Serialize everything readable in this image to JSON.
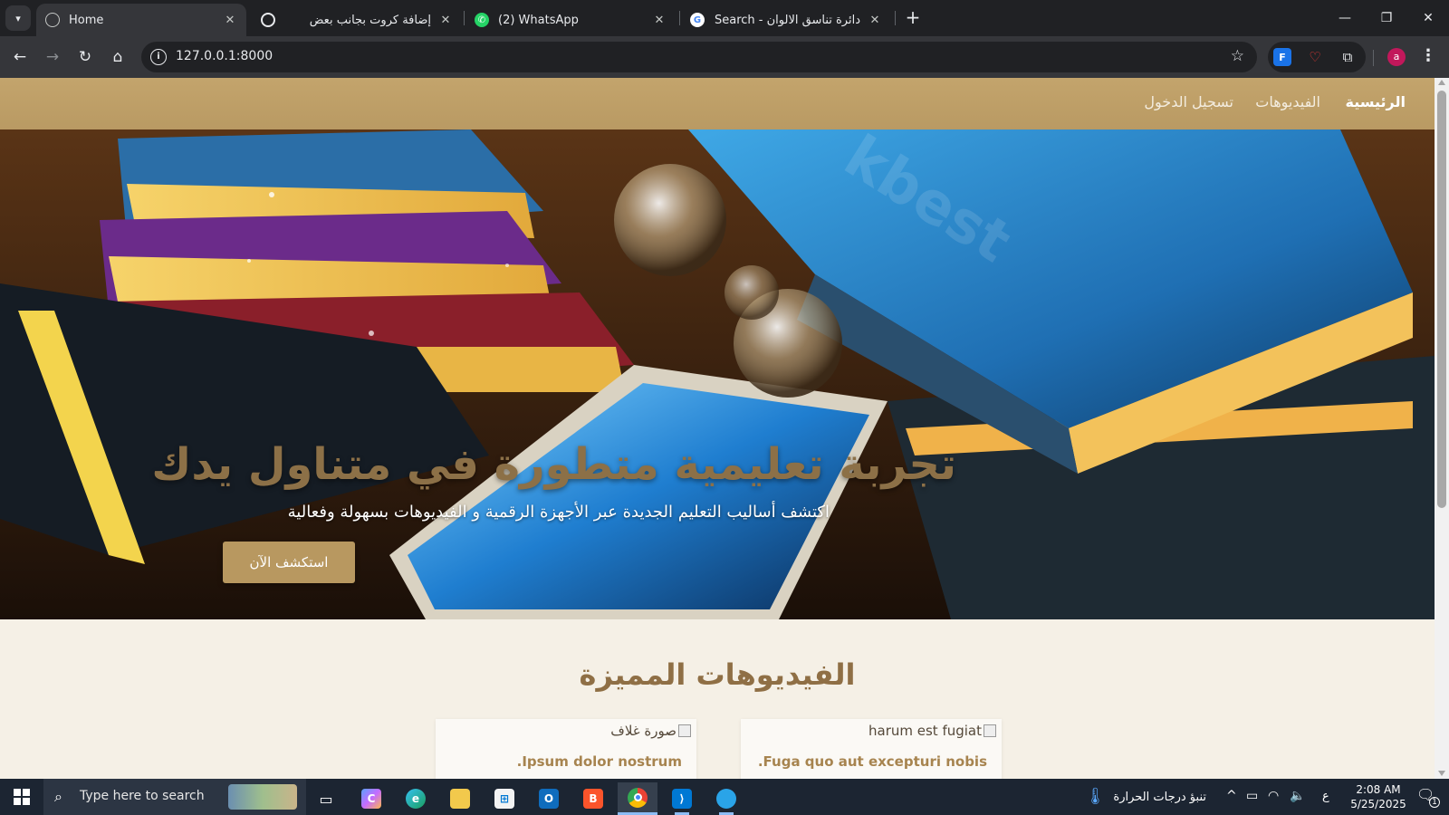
{
  "browser": {
    "tabs": [
      {
        "title": "Home",
        "favicon": "globe-icon",
        "active": true
      },
      {
        "title": "إضافة كروت بجانب بعض",
        "favicon": "chatgpt-icon",
        "active": false
      },
      {
        "title": "(2) WhatsApp",
        "favicon": "whatsapp-icon",
        "active": false
      },
      {
        "title": "دائرة تناسق الالوان - Google Search",
        "favicon": "google-icon",
        "active": false
      }
    ],
    "url": "127.0.0.1:8000",
    "profile_initial": "a",
    "extension_label": "F"
  },
  "site": {
    "nav": {
      "home": "الرئيسية",
      "videos": "الفيديوهات",
      "login": "تسجيل الدخول"
    },
    "hero": {
      "title": "تجربة تعليمية متطورة في متناول يدك",
      "subtitle": "اكتشف أساليب التعليم الجديدة عبر الأجهزة الرقمية و الفيديوهات بسهولة وفعالية",
      "cta": "استكشف الآن",
      "watermark": "kbest"
    },
    "featured": {
      "title": "الفيديوهات المميزة",
      "cards": [
        {
          "image_alt": "harum est fugiat",
          "title": "Fuga quo aut excepturi nobis."
        },
        {
          "image_alt": "صورة غلاف",
          "title": "Ipsum dolor nostrum."
        }
      ]
    }
  },
  "taskbar": {
    "search_placeholder": "Type here to search",
    "weather_text": "تنبؤ درجات الحرارة",
    "input_lang": "ع",
    "time": "2:08 AM",
    "date": "5/25/2025",
    "notification_count": "1"
  },
  "colors": {
    "nav_gold": "#bea068",
    "button_gold": "#b89860",
    "heading_brown": "#8f6f45",
    "card_title": "#a7844f",
    "page_bg": "#f5f0e6"
  }
}
